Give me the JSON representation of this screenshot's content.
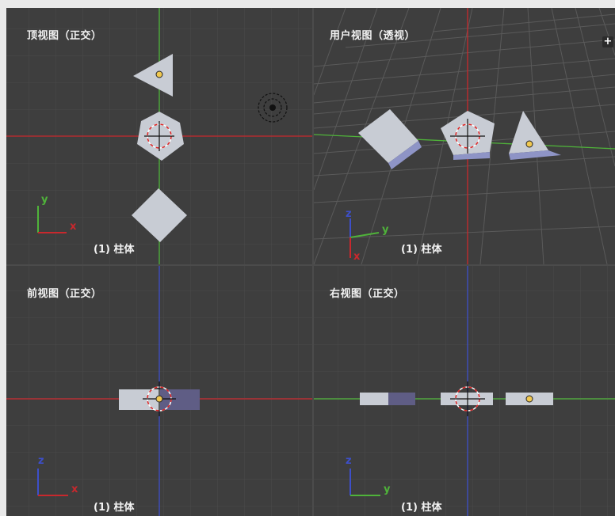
{
  "viewports": {
    "top": {
      "title": "顶视图（正交）",
      "object_label": "(1) 柱体",
      "axis_h": "x",
      "axis_v": "y"
    },
    "user": {
      "title": "用户视图（透视）",
      "object_label": "(1) 柱体",
      "axis_h": "y",
      "axis_v": "z",
      "axis_x": "x",
      "nav_icon": "+"
    },
    "front": {
      "title": "前视图（正交）",
      "object_label": "(1) 柱体",
      "axis_h": "x",
      "axis_v": "z"
    },
    "right": {
      "title": "右视图（正交）",
      "object_label": "(1) 柱体",
      "axis_h": "y",
      "axis_v": "z"
    }
  },
  "colors": {
    "background": "#3e3e3e",
    "grid": "#4a4a4a",
    "x_axis": "#c8282d",
    "y_axis": "#4fb33a",
    "z_axis": "#3d4fc9",
    "object": "#c8ccd4",
    "object_dark": "#5f5d85",
    "origin": "#f0c850"
  }
}
